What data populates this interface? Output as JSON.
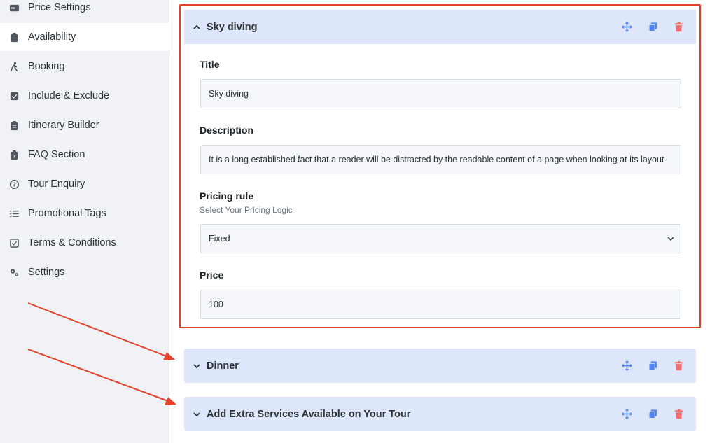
{
  "sidebar": {
    "items": [
      {
        "label": "Price Settings",
        "icon": "price-tag-icon"
      },
      {
        "label": "Availability",
        "icon": "clipboard-icon"
      },
      {
        "label": "Booking",
        "icon": "walking-person-icon"
      },
      {
        "label": "Include & Exclude",
        "icon": "checkbox-icon"
      },
      {
        "label": "Itinerary Builder",
        "icon": "clipboard-list-icon"
      },
      {
        "label": "FAQ Section",
        "icon": "clipboard-question-icon"
      },
      {
        "label": "Tour Enquiry",
        "icon": "question-circle-icon"
      },
      {
        "label": "Promotional Tags",
        "icon": "list-icon"
      },
      {
        "label": "Terms & Conditions",
        "icon": "check-square-icon"
      },
      {
        "label": "Settings",
        "icon": "gears-icon"
      }
    ]
  },
  "services": [
    {
      "title": "Sky diving",
      "expanded": true,
      "fields": {
        "title_label": "Title",
        "title_value": "Sky diving",
        "description_label": "Description",
        "description_value": "It is a long established fact that a reader will be distracted by the readable content of a page when looking at its layout",
        "pricing_rule_label": "Pricing rule",
        "pricing_rule_help": "Select Your Pricing Logic",
        "pricing_rule_value": "Fixed",
        "price_label": "Price",
        "price_value": "100"
      }
    },
    {
      "title": "Dinner",
      "expanded": false
    },
    {
      "title": "Add Extra Services Available on Your Tour",
      "expanded": false
    }
  ],
  "colors": {
    "panel_bg": "#dde6fb",
    "action_icon": "#4f86f7",
    "delete_icon": "#f26d6d",
    "highlight": "#e5422b"
  }
}
